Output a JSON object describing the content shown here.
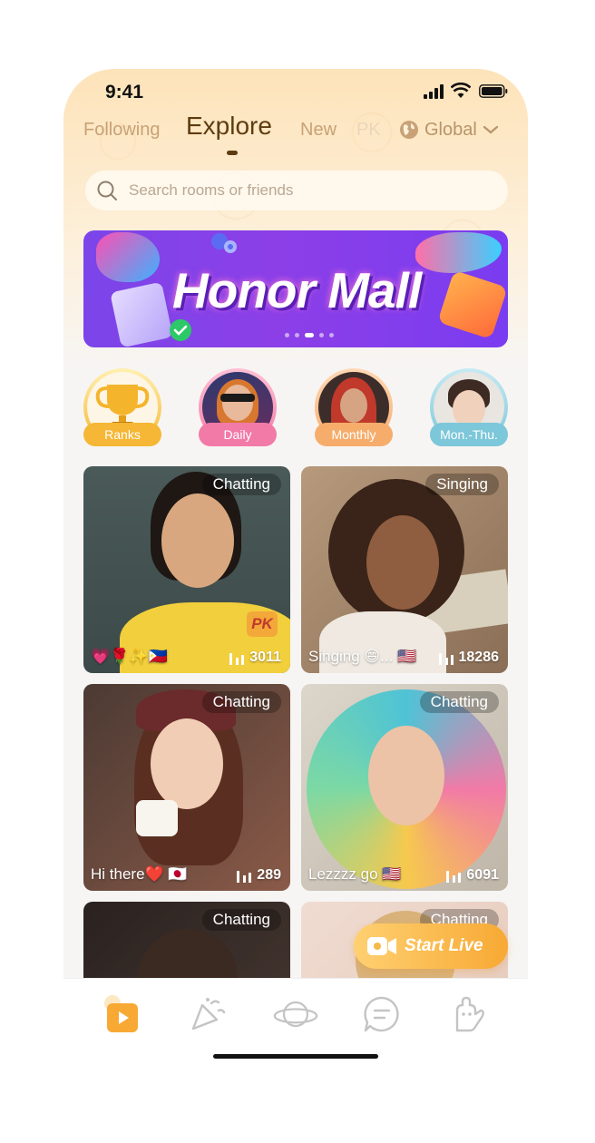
{
  "status_bar": {
    "time": "9:41"
  },
  "tabs": [
    {
      "label": "Following"
    },
    {
      "label": "Explore"
    },
    {
      "label": "New"
    },
    {
      "label": "PK"
    }
  ],
  "region": {
    "label": "Global"
  },
  "search": {
    "placeholder": "Search rooms or friends"
  },
  "banner": {
    "title": "Honor Mall",
    "page_count": 5,
    "active_page": 3
  },
  "rank_categories": [
    {
      "label": "Ranks",
      "color": "#f5b735"
    },
    {
      "label": "Daily",
      "color": "#f27aa7"
    },
    {
      "label": "Monthly",
      "color": "#f6ad6c"
    },
    {
      "label": "Mon.-Thu.",
      "color": "#7cc7d9"
    }
  ],
  "rooms": [
    {
      "tag": "Chatting",
      "caption": "💗🌹✨🇵🇭",
      "viewers": "3011"
    },
    {
      "tag": "Singing",
      "caption": "Singing 😄... 🇺🇸",
      "viewers": "18286"
    },
    {
      "tag": "Chatting",
      "caption": "Hi there❤️ 🇯🇵",
      "viewers": "289"
    },
    {
      "tag": "Chatting",
      "caption": "Lezzzz go 🇺🇸",
      "viewers": "6091"
    },
    {
      "tag": "Chatting",
      "caption": "",
      "viewers": ""
    },
    {
      "tag": "Chatting",
      "caption": "",
      "viewers": ""
    }
  ],
  "start_live": {
    "label": "Start Live"
  },
  "bottom_nav": [
    {
      "icon": "live-video-icon",
      "active": true
    },
    {
      "icon": "party-popper-icon",
      "active": false
    },
    {
      "icon": "planet-icon",
      "active": false
    },
    {
      "icon": "chat-bubble-icon",
      "active": false
    },
    {
      "icon": "profile-hand-icon",
      "active": false
    }
  ],
  "colors": {
    "accent": "#f7a934",
    "tab_active": "#5e3c10",
    "tab_inactive": "#c8a276"
  }
}
